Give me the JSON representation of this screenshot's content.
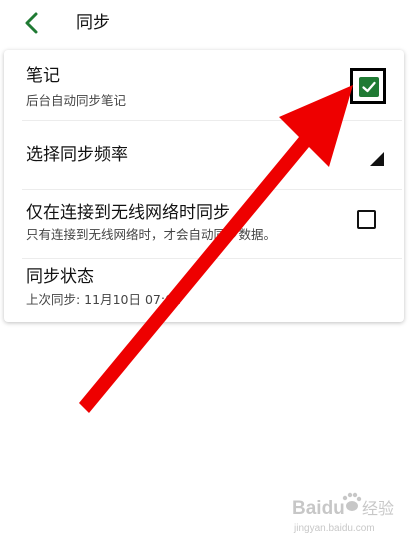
{
  "header": {
    "title": "同步",
    "back_icon": "chevron-left-icon"
  },
  "colors": {
    "accent_green": "#1f7a33",
    "arrow_red": "#ee0000"
  },
  "settings": {
    "notes": {
      "title": "笔记",
      "subtitle": "后台自动同步笔记",
      "checked": true
    },
    "frequency": {
      "title": "选择同步频率",
      "icon": "dropdown-triangle-icon"
    },
    "wifi_only": {
      "title": "仅在连接到无线网络时同步",
      "subtitle": "只有连接到无线网络时，才会自动同步数据。",
      "checked": false
    },
    "status": {
      "title": "同步状态",
      "subtitle": "上次同步: 11月10日 07:02"
    }
  },
  "watermark": {
    "brand": "Baidu",
    "brand_cn": "经验",
    "url": "jingyan.baidu.com"
  }
}
